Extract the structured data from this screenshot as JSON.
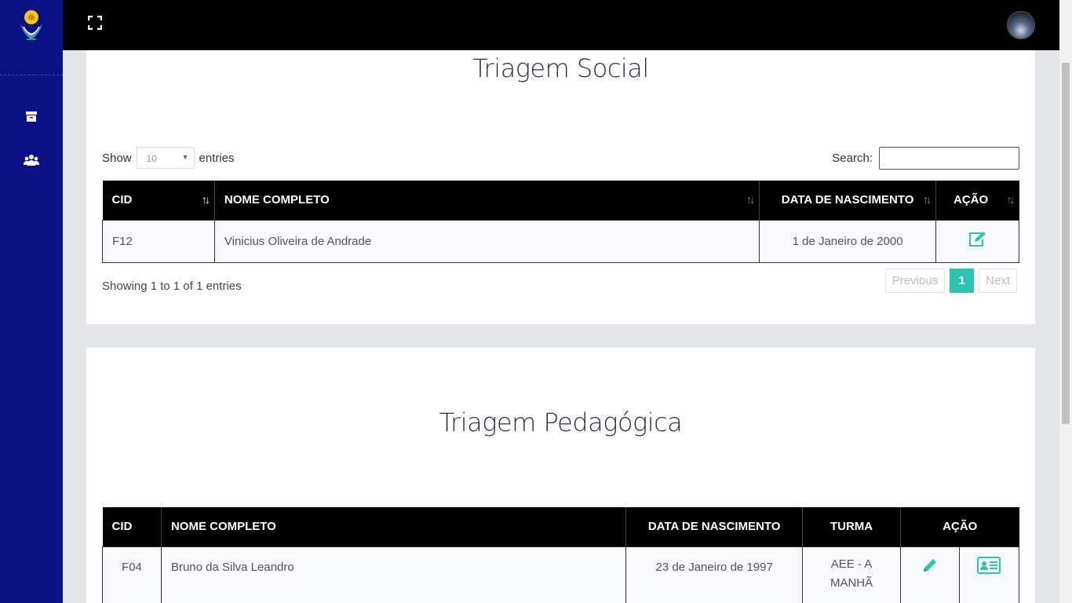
{
  "sidebar": {
    "logo": "emblem-logo",
    "items": [
      {
        "icon": "archive-icon"
      },
      {
        "icon": "users-icon"
      }
    ]
  },
  "topbar": {
    "fullscreen_icon": "expand-icon",
    "avatar": "user-avatar"
  },
  "social": {
    "title": "Triagem Social",
    "show_label": "Show",
    "entries_value": "10",
    "entries_label": "entries",
    "search_label": "Search:",
    "search_value": "",
    "columns": [
      "CID",
      "NOME COMPLETO",
      "DATA DE NASCIMENTO",
      "AÇÃO"
    ],
    "rows": [
      {
        "cid": "F12",
        "nome": "Vinicius Oliveira de Andrade",
        "data": "1 de Janeiro de 2000",
        "acao": "edit-icon"
      }
    ],
    "info": "Showing 1 to 1 of 1 entries",
    "pagination": {
      "previous": "Previous",
      "page": "1",
      "next": "Next"
    }
  },
  "pedagogica": {
    "title": "Triagem Pedagógica",
    "columns": [
      "CID",
      "NOME COMPLETO",
      "DATA DE NASCIMENTO",
      "TURMA",
      "AÇÃO"
    ],
    "rows": [
      {
        "cid": "F04",
        "nome": "Bruno da Silva Leandro",
        "data": "23 de Janeiro de 1997",
        "turma": "AEE - A MANHÃ",
        "acao": [
          "pencil-icon",
          "id-card-icon"
        ]
      }
    ]
  },
  "colors": {
    "sidebar": "#0a1283",
    "topbar": "#000000",
    "accent": "#2fc4b2"
  }
}
